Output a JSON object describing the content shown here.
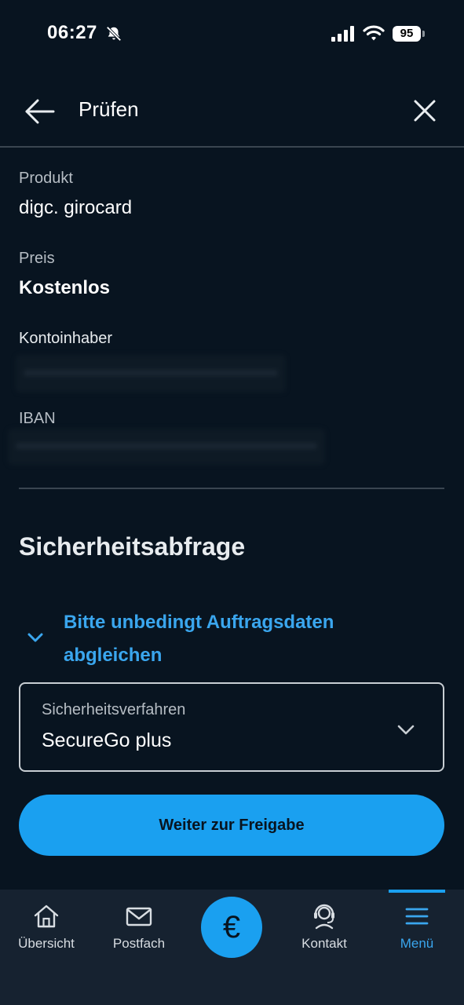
{
  "status_bar": {
    "time": "06:27",
    "battery": "95",
    "icons": [
      "bell-slash-icon",
      "signal-icon",
      "wifi-icon",
      "battery-icon"
    ]
  },
  "header": {
    "title": "Prüfen",
    "back_icon": "arrow-left-icon",
    "close_icon": "close-icon"
  },
  "details": {
    "product_label": "Produkt",
    "product_value": "digc. girocard",
    "price_label": "Preis",
    "price_value": "Kostenlos",
    "holder_label": "Kontoinhaber",
    "iban_label": "IBAN"
  },
  "security": {
    "title": "Sicherheitsabfrage",
    "expand_text": "Bitte unbedingt Auftragsdaten abgleichen",
    "select_label": "Sicherheitsverfahren",
    "select_value": "SecureGo plus",
    "submit_label": "Weiter zur Freigabe"
  },
  "bottom_nav": {
    "items": [
      {
        "label": "Übersicht",
        "icon": "home-icon"
      },
      {
        "label": "Postfach",
        "icon": "mail-icon"
      },
      {
        "label": "",
        "icon": "euro-icon"
      },
      {
        "label": "Kontakt",
        "icon": "headset-icon"
      },
      {
        "label": "Menü",
        "icon": "menu-icon"
      }
    ],
    "euro_symbol": "€",
    "active": "Menü"
  },
  "colors": {
    "background": "#081420",
    "accent": "#1aa0f0",
    "link": "#3aa6ee",
    "nav_background": "#162230"
  }
}
